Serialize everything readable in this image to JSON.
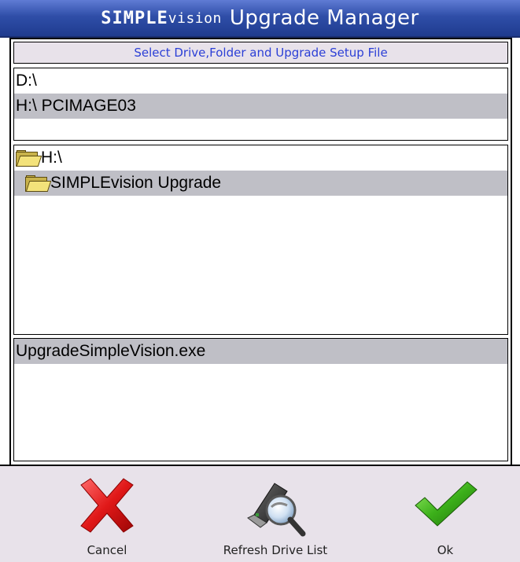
{
  "window": {
    "title_brand": "SIMPLE",
    "title_brand_sub": "vision",
    "title_text": "Upgrade Manager"
  },
  "subtitle": "Select Drive,Folder and Upgrade Setup File",
  "drives": [
    {
      "label": "D:\\",
      "selected": false
    },
    {
      "label": "H:\\ PCIMAGE03",
      "selected": true
    }
  ],
  "folders": [
    {
      "label": "H:\\",
      "selected": false,
      "icon": "folder-open-icon"
    },
    {
      "label": "SIMPLEvision Upgrade",
      "selected": true,
      "icon": "folder-open-icon"
    }
  ],
  "files": [
    {
      "label": "UpgradeSimpleVision.exe",
      "selected": true
    }
  ],
  "toolbar": {
    "cancel_label": "Cancel",
    "refresh_label": "Refresh Drive List",
    "ok_label": "Ok"
  },
  "colors": {
    "title_bar": "#2f4ea8",
    "subtitle_text": "#2b3fd6",
    "selection": "#bfbfc6",
    "panel_bg": "#e8e2ea",
    "cancel_red": "#e01818",
    "ok_green": "#3cb01a"
  }
}
